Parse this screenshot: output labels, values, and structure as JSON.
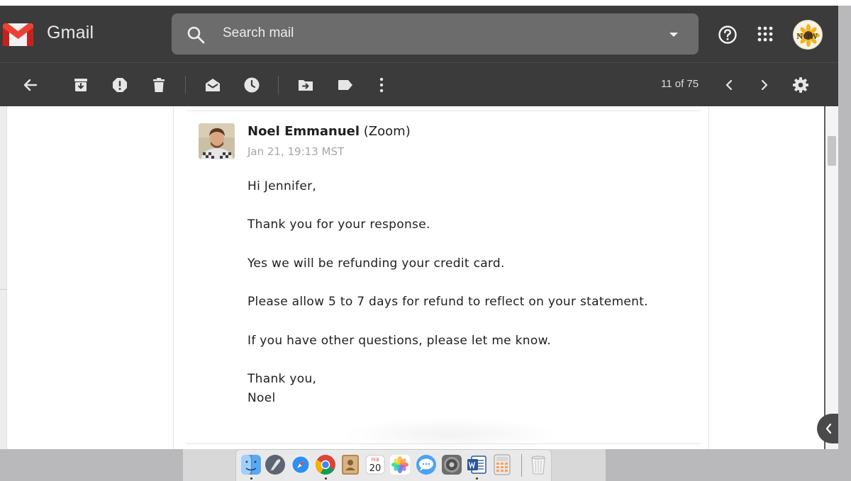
{
  "app": {
    "logo_text": "Gmail"
  },
  "search": {
    "placeholder": "Search mail"
  },
  "toolbar": {
    "page_count": "11 of 75"
  },
  "message": {
    "sender_name": "Noel Emmanuel",
    "sender_org": "(Zoom)",
    "date": "Jan 21, 19:13 MST",
    "body": [
      "Hi Jennifer,",
      "Thank you for your response.",
      "Yes we will be refunding your credit card.",
      "Please allow 5 to 7 days for refund to reflect on your statement.",
      "If you have other questions, please let me know."
    ],
    "signoff": "Thank you,",
    "signature": "Noel"
  },
  "avatar": {
    "text": "NOW"
  },
  "dock": {
    "calendar_day": "20",
    "calendar_month": "FEB"
  },
  "colors": {
    "header_bg": "#3b3b3b",
    "search_bg": "#6c6c6c",
    "gmail_red": "#d93025"
  },
  "icons": [
    "gmail-logo",
    "search-icon",
    "dropdown-arrow-icon",
    "help-icon",
    "apps-grid-icon",
    "back-arrow-icon",
    "archive-icon",
    "report-spam-icon",
    "delete-icon",
    "mark-unread-icon",
    "snooze-icon",
    "move-to-icon",
    "label-icon",
    "more-icon",
    "chevron-left-icon",
    "chevron-right-icon",
    "settings-gear-icon"
  ]
}
